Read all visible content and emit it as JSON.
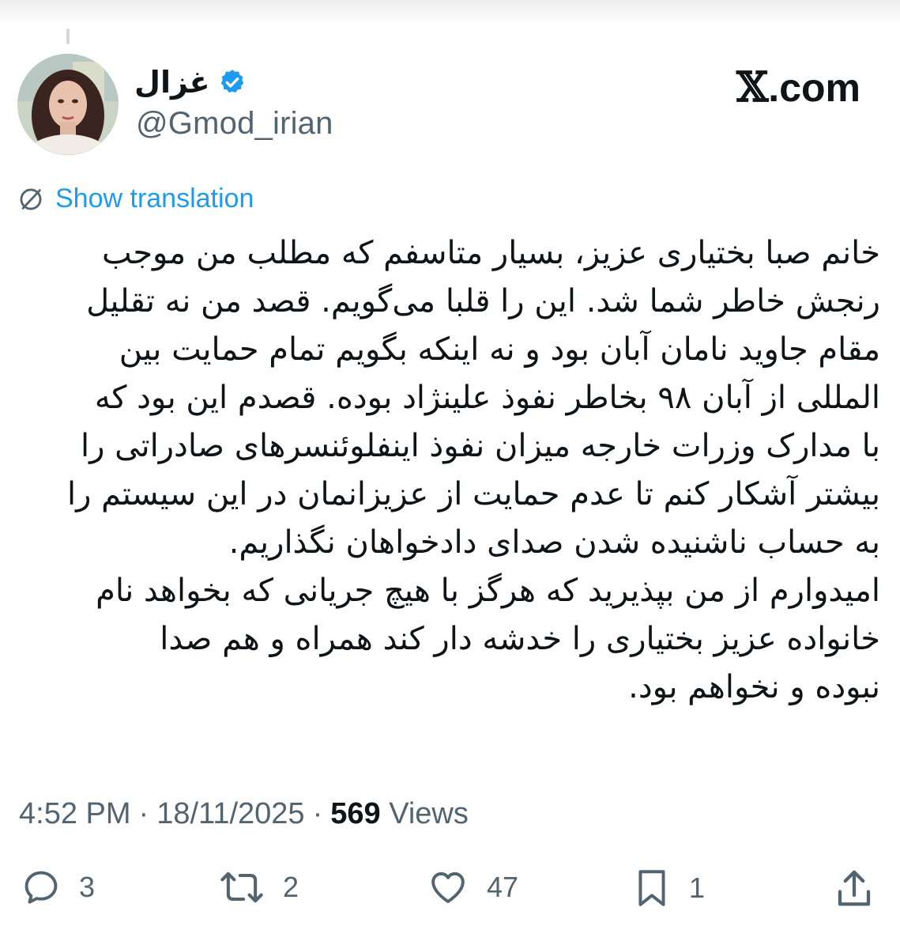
{
  "author": {
    "display_name": "غزال",
    "handle": "@Gmod_irian",
    "verified": true,
    "avatar_icon": "profile-photo-icon"
  },
  "brand": {
    "x_letter": "𝕏",
    "suffix": ".com"
  },
  "translate": {
    "label": "Show translation",
    "icon": "globe-slash-icon"
  },
  "tweet": {
    "lines": [
      "خانم صبا بختیاری عزیز، بسیار متاسفم که مطلب من موجب",
      "رنجش خاطر شما شد. این را قلبا می‌گویم. قصد من نه تقلیل",
      "مقام جاوید نامان آبان بود و نه اینکه بگویم تمام حمایت بین",
      "المللی از آبان ۹۸ بخاطر نفوذ علینژاد بوده. قصدم این بود که",
      "با مدارک وزرات خارجه میزان نفوذ اینفلوئنسرهای صادراتی را",
      "بیشتر آشکار کنم تا عدم حمایت از عزیزانمان در این سیستم را",
      "به حساب ناشنیده شدن صدای دادخواهان  نگذاریم.",
      "امیدوارم از من بپذیرید که هرگز با هیچ جریانی که بخواهد نام",
      "خانواده عزیز بختیاری را خدشه دار کند همراه و هم صدا",
      "نبوده و نخواهم بود."
    ]
  },
  "meta": {
    "time": "4:52 PM",
    "sep1": "·",
    "date": "18/11/2025",
    "sep2": "·",
    "views_count": "569",
    "views_label": "Views"
  },
  "actions": {
    "replies": "3",
    "reposts": "2",
    "likes": "47",
    "bookmarks": "1"
  },
  "colors": {
    "accent": "#1d9bf0",
    "text": "#0f1419",
    "secondary": "#536471"
  }
}
